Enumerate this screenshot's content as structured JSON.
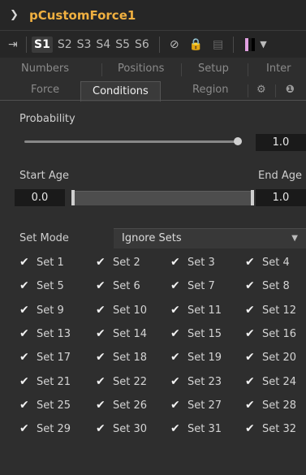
{
  "header": {
    "title": "pCustomForce1"
  },
  "toolbar": {
    "slots": [
      "S1",
      "S2",
      "S3",
      "S4",
      "S5",
      "S6"
    ],
    "active_slot": "S1",
    "color_swatch": [
      "#e0a0e0",
      "#1a1a1a",
      "#000000"
    ]
  },
  "tabs_row1": [
    "Numbers",
    "Positions",
    "Setup",
    "Inter"
  ],
  "tabs_row2": {
    "force": "Force",
    "conditions": "Conditions",
    "region": "Region"
  },
  "probability": {
    "label": "Probability",
    "value": "1.0",
    "fill": 1.0
  },
  "start_age": {
    "label": "Start Age",
    "value": "0.0"
  },
  "end_age": {
    "label": "End Age",
    "value": "1.0"
  },
  "set_mode": {
    "label": "Set Mode",
    "selected": "Ignore Sets"
  },
  "sets": [
    "Set 1",
    "Set 2",
    "Set 3",
    "Set 4",
    "Set 5",
    "Set 6",
    "Set 7",
    "Set 8",
    "Set 9",
    "Set 10",
    "Set 11",
    "Set 12",
    "Set 13",
    "Set 14",
    "Set 15",
    "Set 16",
    "Set 17",
    "Set 18",
    "Set 19",
    "Set 20",
    "Set 21",
    "Set 22",
    "Set 23",
    "Set 24",
    "Set 25",
    "Set 26",
    "Set 27",
    "Set 28",
    "Set 29",
    "Set 30",
    "Set 31",
    "Set 32"
  ],
  "colors": {
    "title": "#f0b040",
    "panel": "#2e2e2e",
    "valuebox": "#1a1a1a"
  }
}
